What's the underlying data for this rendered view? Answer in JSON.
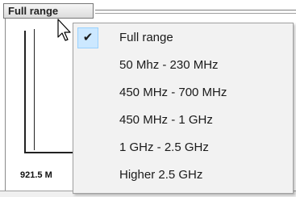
{
  "range_button": {
    "label": "Full range"
  },
  "chart": {
    "freq_label": "921.5 M"
  },
  "menu": {
    "items": [
      {
        "label": "Full range",
        "checked": true
      },
      {
        "label": "50 Mhz - 230 MHz",
        "checked": false
      },
      {
        "label": "450 MHz - 700 MHz",
        "checked": false
      },
      {
        "label": "450 MHz - 1 GHz",
        "checked": false
      },
      {
        "label": "1 GHz - 2.5 GHz",
        "checked": false
      },
      {
        "label": "Higher 2.5 GHz",
        "checked": false
      }
    ],
    "check_glyph": "✔"
  },
  "colors": {
    "check_highlight": "#cce8ff",
    "menu_bg": "#f2f2f2"
  },
  "icons": {
    "cursor": "arrow-cursor-icon",
    "check": "check-icon"
  }
}
